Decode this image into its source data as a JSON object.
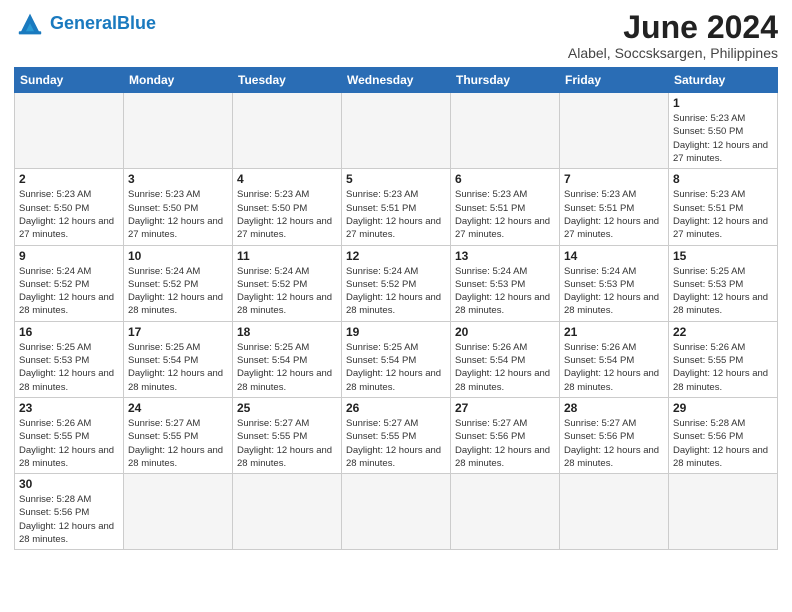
{
  "logo": {
    "text_general": "General",
    "text_blue": "Blue"
  },
  "header": {
    "month_title": "June 2024",
    "subtitle": "Alabel, Soccsksargen, Philippines"
  },
  "weekdays": [
    "Sunday",
    "Monday",
    "Tuesday",
    "Wednesday",
    "Thursday",
    "Friday",
    "Saturday"
  ],
  "weeks": [
    [
      {
        "day": "",
        "info": "",
        "empty": true
      },
      {
        "day": "",
        "info": "",
        "empty": true
      },
      {
        "day": "",
        "info": "",
        "empty": true
      },
      {
        "day": "",
        "info": "",
        "empty": true
      },
      {
        "day": "",
        "info": "",
        "empty": true
      },
      {
        "day": "",
        "info": "",
        "empty": true
      },
      {
        "day": "1",
        "info": "Sunrise: 5:23 AM\nSunset: 5:50 PM\nDaylight: 12 hours and 27 minutes."
      }
    ],
    [
      {
        "day": "2",
        "info": "Sunrise: 5:23 AM\nSunset: 5:50 PM\nDaylight: 12 hours and 27 minutes."
      },
      {
        "day": "3",
        "info": "Sunrise: 5:23 AM\nSunset: 5:50 PM\nDaylight: 12 hours and 27 minutes."
      },
      {
        "day": "4",
        "info": "Sunrise: 5:23 AM\nSunset: 5:50 PM\nDaylight: 12 hours and 27 minutes."
      },
      {
        "day": "5",
        "info": "Sunrise: 5:23 AM\nSunset: 5:51 PM\nDaylight: 12 hours and 27 minutes."
      },
      {
        "day": "6",
        "info": "Sunrise: 5:23 AM\nSunset: 5:51 PM\nDaylight: 12 hours and 27 minutes."
      },
      {
        "day": "7",
        "info": "Sunrise: 5:23 AM\nSunset: 5:51 PM\nDaylight: 12 hours and 27 minutes."
      },
      {
        "day": "8",
        "info": "Sunrise: 5:23 AM\nSunset: 5:51 PM\nDaylight: 12 hours and 27 minutes."
      }
    ],
    [
      {
        "day": "9",
        "info": "Sunrise: 5:24 AM\nSunset: 5:52 PM\nDaylight: 12 hours and 28 minutes."
      },
      {
        "day": "10",
        "info": "Sunrise: 5:24 AM\nSunset: 5:52 PM\nDaylight: 12 hours and 28 minutes."
      },
      {
        "day": "11",
        "info": "Sunrise: 5:24 AM\nSunset: 5:52 PM\nDaylight: 12 hours and 28 minutes."
      },
      {
        "day": "12",
        "info": "Sunrise: 5:24 AM\nSunset: 5:52 PM\nDaylight: 12 hours and 28 minutes."
      },
      {
        "day": "13",
        "info": "Sunrise: 5:24 AM\nSunset: 5:53 PM\nDaylight: 12 hours and 28 minutes."
      },
      {
        "day": "14",
        "info": "Sunrise: 5:24 AM\nSunset: 5:53 PM\nDaylight: 12 hours and 28 minutes."
      },
      {
        "day": "15",
        "info": "Sunrise: 5:25 AM\nSunset: 5:53 PM\nDaylight: 12 hours and 28 minutes."
      }
    ],
    [
      {
        "day": "16",
        "info": "Sunrise: 5:25 AM\nSunset: 5:53 PM\nDaylight: 12 hours and 28 minutes."
      },
      {
        "day": "17",
        "info": "Sunrise: 5:25 AM\nSunset: 5:54 PM\nDaylight: 12 hours and 28 minutes."
      },
      {
        "day": "18",
        "info": "Sunrise: 5:25 AM\nSunset: 5:54 PM\nDaylight: 12 hours and 28 minutes."
      },
      {
        "day": "19",
        "info": "Sunrise: 5:25 AM\nSunset: 5:54 PM\nDaylight: 12 hours and 28 minutes."
      },
      {
        "day": "20",
        "info": "Sunrise: 5:26 AM\nSunset: 5:54 PM\nDaylight: 12 hours and 28 minutes."
      },
      {
        "day": "21",
        "info": "Sunrise: 5:26 AM\nSunset: 5:54 PM\nDaylight: 12 hours and 28 minutes."
      },
      {
        "day": "22",
        "info": "Sunrise: 5:26 AM\nSunset: 5:55 PM\nDaylight: 12 hours and 28 minutes."
      }
    ],
    [
      {
        "day": "23",
        "info": "Sunrise: 5:26 AM\nSunset: 5:55 PM\nDaylight: 12 hours and 28 minutes."
      },
      {
        "day": "24",
        "info": "Sunrise: 5:27 AM\nSunset: 5:55 PM\nDaylight: 12 hours and 28 minutes."
      },
      {
        "day": "25",
        "info": "Sunrise: 5:27 AM\nSunset: 5:55 PM\nDaylight: 12 hours and 28 minutes."
      },
      {
        "day": "26",
        "info": "Sunrise: 5:27 AM\nSunset: 5:55 PM\nDaylight: 12 hours and 28 minutes."
      },
      {
        "day": "27",
        "info": "Sunrise: 5:27 AM\nSunset: 5:56 PM\nDaylight: 12 hours and 28 minutes."
      },
      {
        "day": "28",
        "info": "Sunrise: 5:27 AM\nSunset: 5:56 PM\nDaylight: 12 hours and 28 minutes."
      },
      {
        "day": "29",
        "info": "Sunrise: 5:28 AM\nSunset: 5:56 PM\nDaylight: 12 hours and 28 minutes."
      }
    ],
    [
      {
        "day": "30",
        "info": "Sunrise: 5:28 AM\nSunset: 5:56 PM\nDaylight: 12 hours and 28 minutes."
      },
      {
        "day": "",
        "info": "",
        "empty": true
      },
      {
        "day": "",
        "info": "",
        "empty": true
      },
      {
        "day": "",
        "info": "",
        "empty": true
      },
      {
        "day": "",
        "info": "",
        "empty": true
      },
      {
        "day": "",
        "info": "",
        "empty": true
      },
      {
        "day": "",
        "info": "",
        "empty": true
      }
    ]
  ]
}
